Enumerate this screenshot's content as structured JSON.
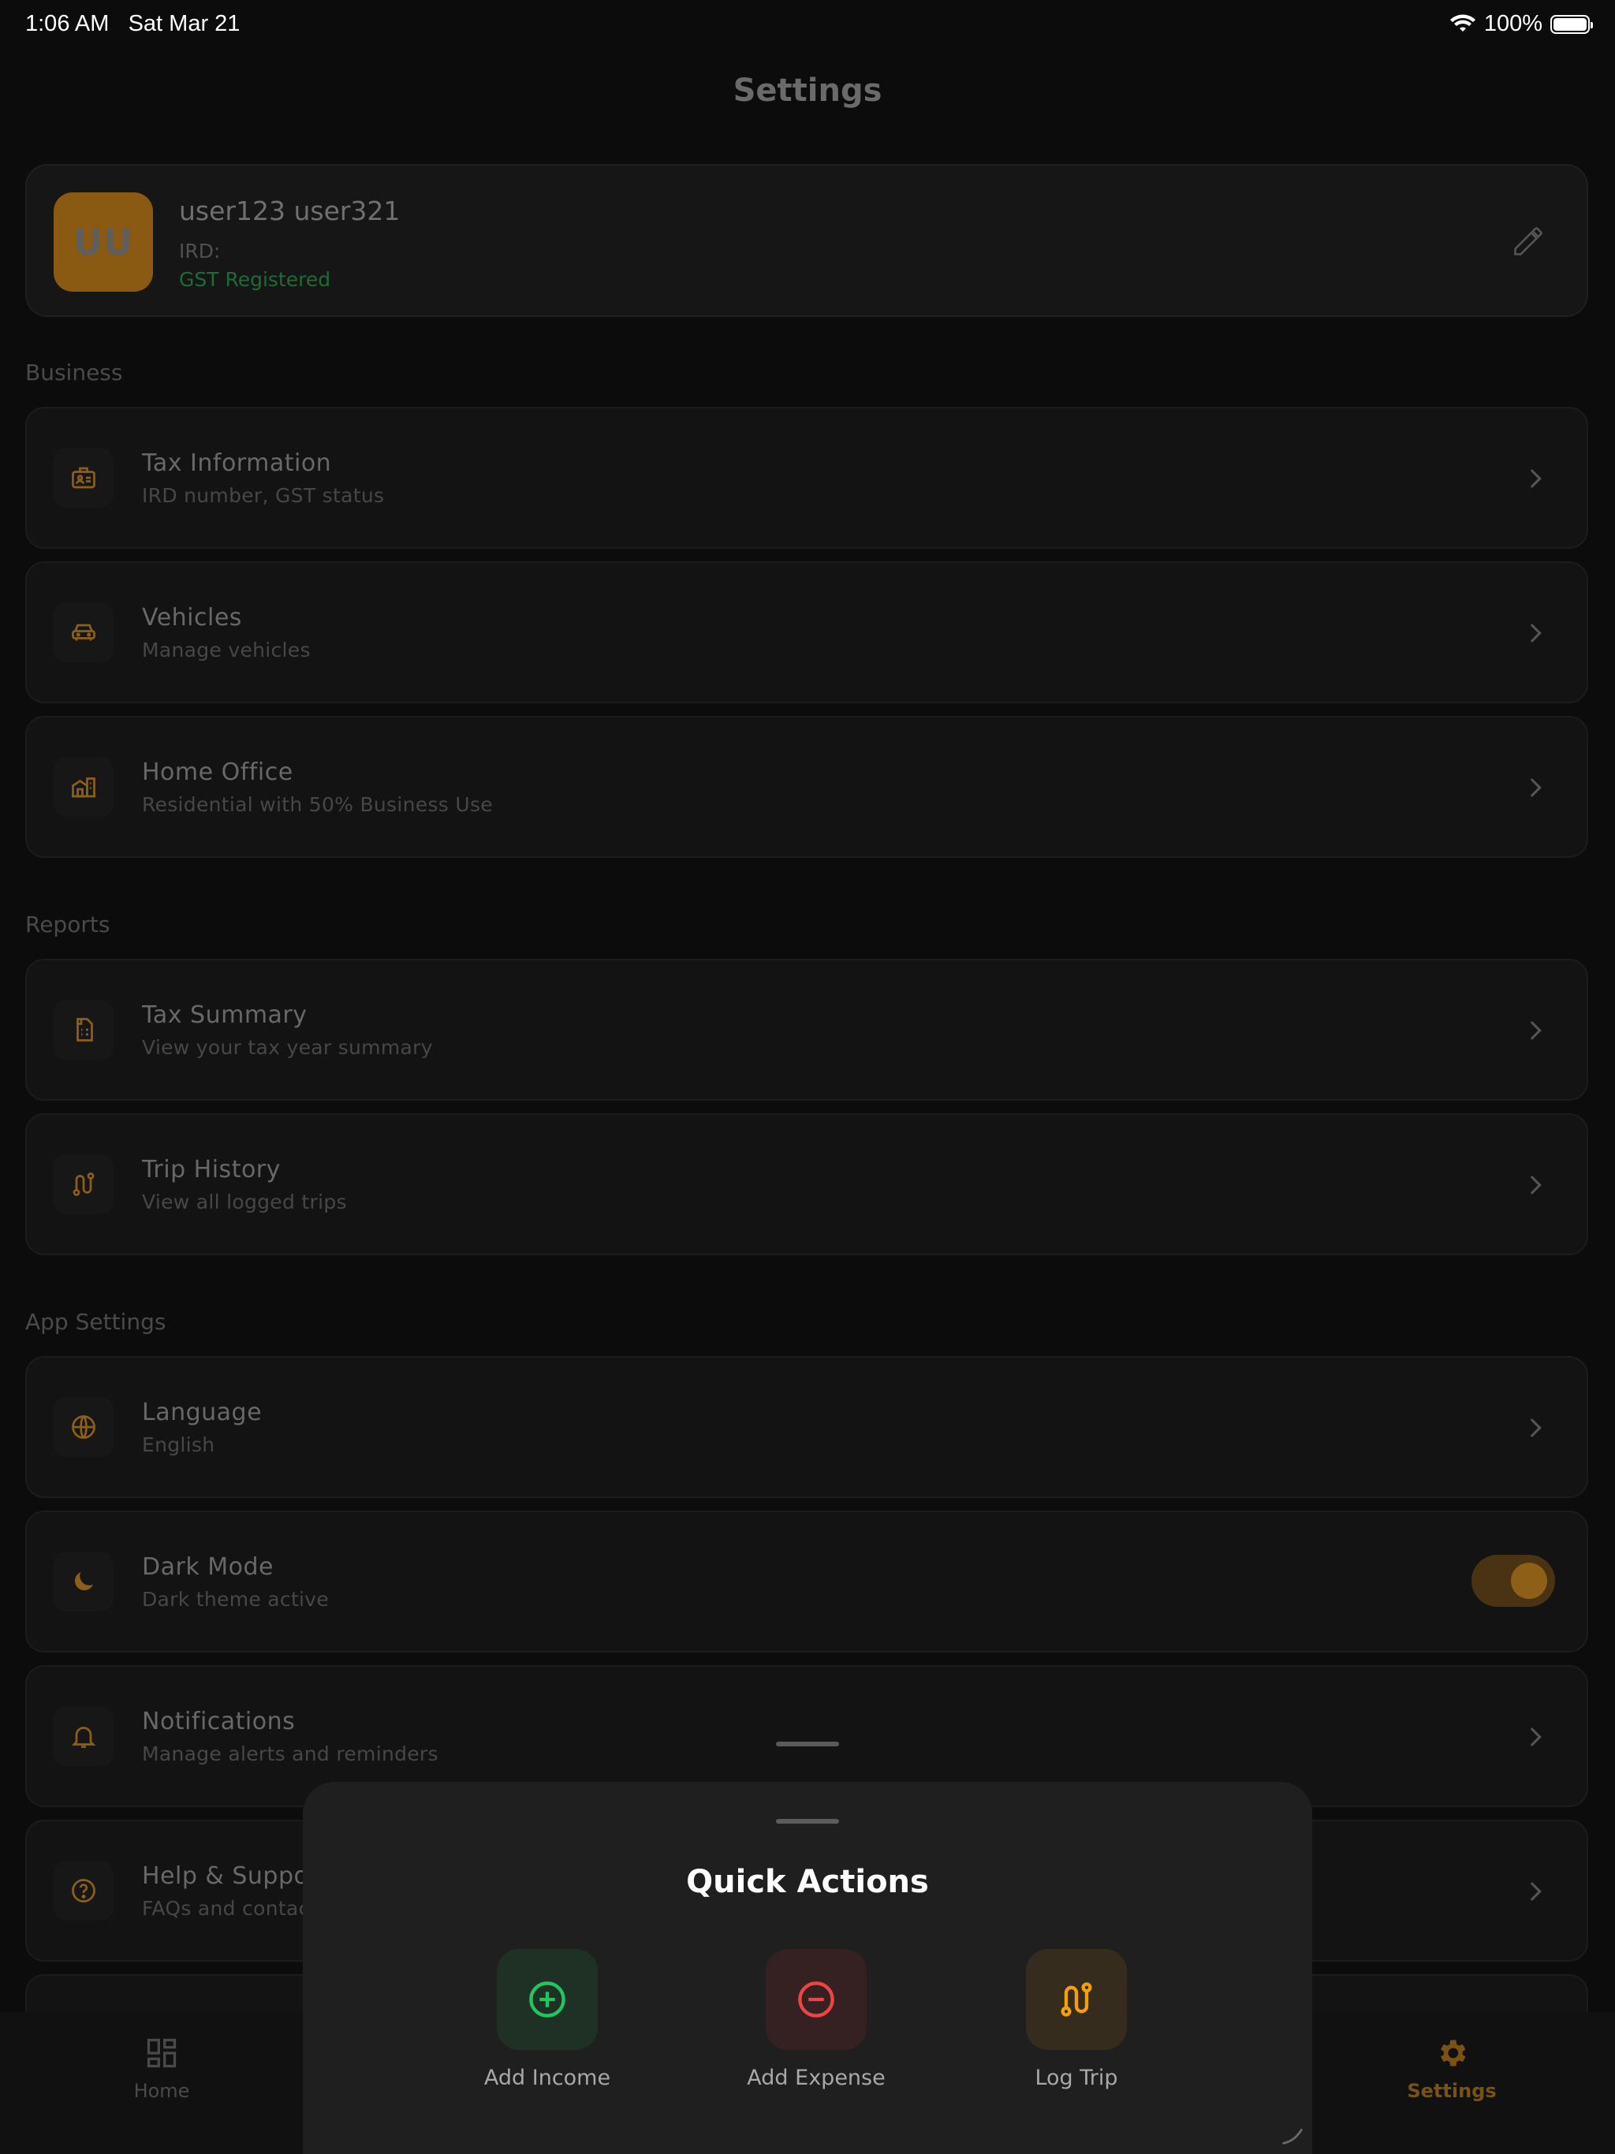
{
  "status_bar": {
    "time": "1:06 AM",
    "date": "Sat Mar 21",
    "battery": "100%",
    "wifi_icon": "wifi-icon",
    "battery_icon": "battery-icon"
  },
  "header": {
    "title": "Settings"
  },
  "profile": {
    "initials": "UU",
    "name": "user123 user321",
    "ird": "IRD:",
    "gst_status": "GST Registered",
    "edit_icon": "pencil-icon"
  },
  "sections": {
    "business": {
      "label": "Business",
      "items": [
        {
          "title": "Tax Information",
          "subtitle": "IRD number, GST status",
          "icon": "id-card-icon"
        },
        {
          "title": "Vehicles",
          "subtitle": "Manage vehicles",
          "icon": "car-icon"
        },
        {
          "title": "Home Office",
          "subtitle": "Residential with 50% Business Use",
          "icon": "building-icon"
        }
      ]
    },
    "reports": {
      "label": "Reports",
      "items": [
        {
          "title": "Tax Summary",
          "subtitle": "View your tax year summary",
          "icon": "document-icon"
        },
        {
          "title": "Trip History",
          "subtitle": "View all logged trips",
          "icon": "route-icon"
        }
      ]
    },
    "app_settings": {
      "label": "App Settings",
      "items": [
        {
          "title": "Language",
          "subtitle": "English",
          "icon": "globe-icon"
        },
        {
          "title": "Dark Mode",
          "subtitle": "Dark theme active",
          "icon": "moon-icon",
          "toggle_on": true
        },
        {
          "title": "Notifications",
          "subtitle": "Manage alerts and reminders",
          "icon": "bell-icon"
        },
        {
          "title": "Help & Suppor",
          "subtitle": "FAQs and contac",
          "icon": "question-icon"
        }
      ]
    }
  },
  "tab_bar": {
    "tabs": [
      {
        "label": "Home",
        "icon": "dashboard-icon",
        "active": false
      },
      {
        "label": "Settings",
        "icon": "gear-icon",
        "active": true
      }
    ]
  },
  "quick_actions": {
    "title": "Quick Actions",
    "actions": [
      {
        "label": "Add Income",
        "icon": "plus-circle-icon",
        "color": "#22c55e",
        "bg": "#1f3124"
      },
      {
        "label": "Add Expense",
        "icon": "minus-circle-icon",
        "color": "#ef4444",
        "bg": "#352121"
      },
      {
        "label": "Log Trip",
        "icon": "route-icon",
        "color": "#f59e0b",
        "bg": "#352c1d"
      }
    ]
  },
  "colors": {
    "accent": "#8e5f16",
    "gst_green": "#1f6b34",
    "background": "#0c0c0c"
  }
}
